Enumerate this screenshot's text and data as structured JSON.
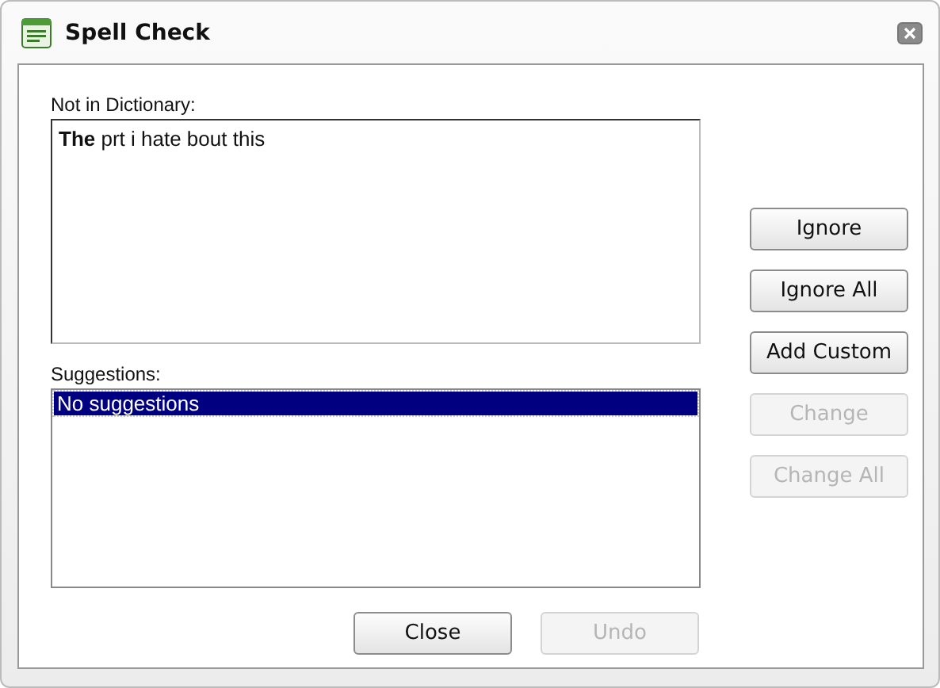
{
  "window": {
    "title": "Spell Check"
  },
  "not_in_dictionary": {
    "label": "Not in Dictionary:",
    "text": "**The** prt i hate bout this"
  },
  "suggestions": {
    "label": "Suggestions:",
    "items": [
      {
        "text": "No suggestions",
        "selected": true
      }
    ]
  },
  "side_buttons": [
    {
      "label": "Ignore",
      "disabled": false
    },
    {
      "label": "Ignore All",
      "disabled": false
    },
    {
      "label": "Add Custom",
      "disabled": false
    },
    {
      "label": "Change",
      "disabled": true
    },
    {
      "label": "Change All",
      "disabled": true
    }
  ],
  "bottom_buttons": [
    {
      "label": "Close",
      "disabled": false
    },
    {
      "label": "Undo",
      "disabled": true
    }
  ]
}
